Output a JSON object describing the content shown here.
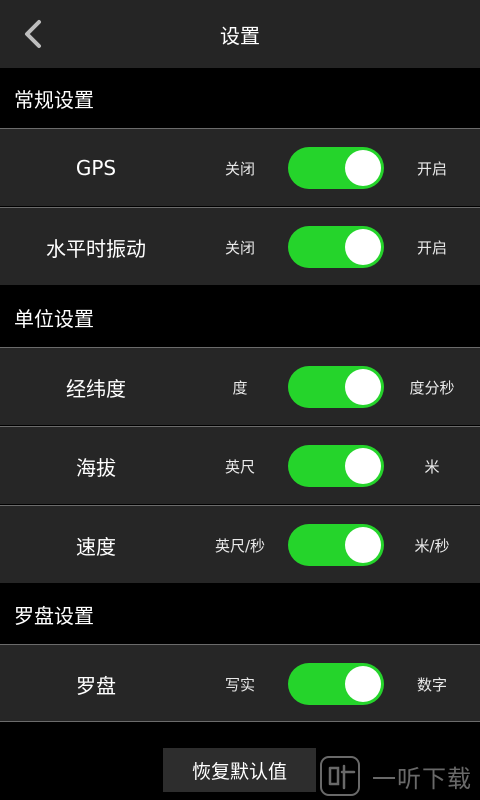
{
  "header": {
    "title": "设置"
  },
  "sections": [
    {
      "title": "常规设置"
    },
    {
      "title": "单位设置"
    },
    {
      "title": "罗盘设置"
    }
  ],
  "rows": [
    {
      "label": "GPS",
      "left": "关闭",
      "right": "开启",
      "toggle_on": true
    },
    {
      "label": "水平时振动",
      "left": "关闭",
      "right": "开启",
      "toggle_on": true
    },
    {
      "label": "经纬度",
      "left": "度",
      "right": "度分秒",
      "toggle_on": true
    },
    {
      "label": "海拔",
      "left": "英尺",
      "right": "米",
      "toggle_on": true
    },
    {
      "label": "速度",
      "left": "英尺/秒",
      "right": "米/秒",
      "toggle_on": true
    },
    {
      "label": "罗盘",
      "left": "写实",
      "right": "数字",
      "toggle_on": true
    }
  ],
  "footer": {
    "reset_label": "恢复默认值"
  },
  "watermark": {
    "text": "一听下载"
  },
  "colors": {
    "toggle_on": "#25d42b",
    "row_bg": "#262626",
    "header_bg": "#252525"
  },
  "icons": {
    "back": "chevron-left-icon",
    "watermark_logo": "ting-logo-icon"
  }
}
